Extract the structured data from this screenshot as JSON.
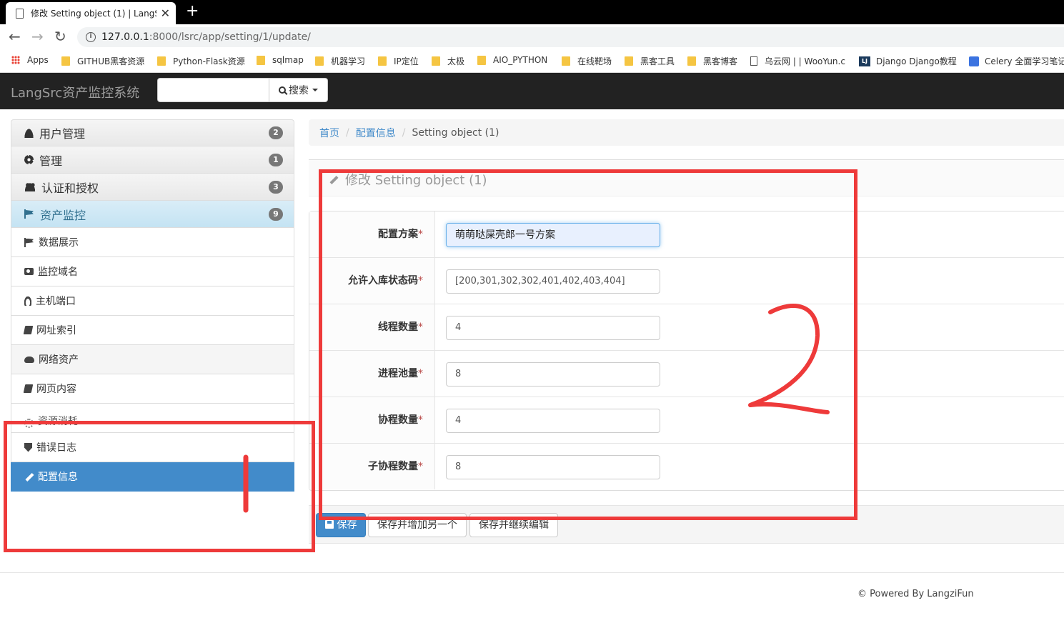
{
  "browser": {
    "tab_title": "修改 Setting object (1) | LangSr",
    "url_host": "127.0.0.1",
    "url_rest": ":8000/lsrc/app/setting/1/update/",
    "bookmarks": [
      {
        "label": "Apps",
        "icon": "apps-grid-icon"
      },
      {
        "label": "GITHUB黑客资源",
        "icon": "folder-icon"
      },
      {
        "label": "Python-Flask资源",
        "icon": "folder-icon"
      },
      {
        "label": "sqlmap",
        "icon": "folder-icon"
      },
      {
        "label": "机器学习",
        "icon": "folder-icon"
      },
      {
        "label": "IP定位",
        "icon": "folder-icon"
      },
      {
        "label": "太极",
        "icon": "folder-icon"
      },
      {
        "label": "AIO_PYTHON",
        "icon": "folder-icon"
      },
      {
        "label": "在线靶场",
        "icon": "folder-icon"
      },
      {
        "label": "黑客工具",
        "icon": "folder-icon"
      },
      {
        "label": "黑客博客",
        "icon": "folder-icon"
      },
      {
        "label": "乌云网 | | WooYun.c",
        "icon": "page-icon"
      },
      {
        "label": "Django Django教程",
        "icon": "lj-icon"
      },
      {
        "label": "Celery 全面学习笔记",
        "icon": "pen-icon"
      }
    ]
  },
  "navbar": {
    "brand": "LangSrc资产监控系统",
    "search_value": "",
    "search_label": "搜索"
  },
  "sidebar": {
    "groups": [
      {
        "label": "用户管理",
        "badge": "2",
        "icon": "user-icon"
      },
      {
        "label": "管理",
        "badge": "1",
        "icon": "gear-icon"
      },
      {
        "label": "认证和授权",
        "badge": "3",
        "icon": "users-icon"
      },
      {
        "label": "资产监控",
        "badge": "9",
        "icon": "flag-icon"
      }
    ],
    "items": [
      {
        "label": "数据展示",
        "icon": "flag-icon"
      },
      {
        "label": "监控域名",
        "icon": "camera-icon"
      },
      {
        "label": "主机端口",
        "icon": "linux-icon"
      },
      {
        "label": "网址索引",
        "icon": "book-icon"
      },
      {
        "label": "网络资产",
        "icon": "cloud-icon"
      },
      {
        "label": "网页内容",
        "icon": "book-icon"
      },
      {
        "label": "资源消耗",
        "icon": "spinner-icon"
      },
      {
        "label": "错误日志",
        "icon": "shield-icon"
      },
      {
        "label": "配置信息",
        "icon": "pencil-icon"
      }
    ]
  },
  "breadcrumb": {
    "home": "首页",
    "section": "配置信息",
    "current": "Setting object (1)"
  },
  "page": {
    "title": "修改 Setting object (1)"
  },
  "form": {
    "required_mark": "*",
    "fields": [
      {
        "label": "配置方案",
        "value": "萌萌哒屎壳郎一号方案"
      },
      {
        "label": "允许入库状态码",
        "value": "[200,301,302,302,401,402,403,404]"
      },
      {
        "label": "线程数量",
        "value": "4"
      },
      {
        "label": "进程池量",
        "value": "8"
      },
      {
        "label": "协程数量",
        "value": "4"
      },
      {
        "label": "子协程数量",
        "value": "8"
      }
    ]
  },
  "actions": {
    "save": "保存",
    "save_add": "保存并增加另一个",
    "save_continue": "保存并继续编辑"
  },
  "footer": {
    "text": "© Powered By LangziFun"
  },
  "annotations": {
    "label_1": "1",
    "label_2": "2",
    "color": "#ee3a3a"
  },
  "colors": {
    "primary": "#428bca",
    "navbar": "#222222",
    "active_group": "#d9edf7"
  }
}
